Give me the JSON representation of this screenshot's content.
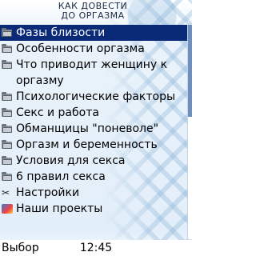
{
  "header": {
    "line1": "КАК ДОВЕСТИ",
    "line2": "ДО ОРГАЗМА"
  },
  "menu": {
    "items": [
      {
        "label": "Фазы близости",
        "icon": "folder-icon",
        "selected": true
      },
      {
        "label": "Особенности оргазма",
        "icon": "folder-icon"
      },
      {
        "label": "Что приводит женщину к оргазму",
        "icon": "folder-icon"
      },
      {
        "label": "Психологические факторы",
        "icon": "folder-icon"
      },
      {
        "label": "Секс и работа",
        "icon": "folder-icon"
      },
      {
        "label": "Обманщицы \"поневоле\"",
        "icon": "folder-icon"
      },
      {
        "label": "Оргазм и беременность",
        "icon": "folder-icon"
      },
      {
        "label": "Условия для секса",
        "icon": "folder-icon"
      },
      {
        "label": "6 правил секса",
        "icon": "folder-icon"
      },
      {
        "label": "Настройки",
        "icon": "wrench-icon"
      },
      {
        "label": "Наши проекты",
        "icon": "projects-icon"
      }
    ]
  },
  "softkeys": {
    "left": "Выбор",
    "clock": "12:45"
  },
  "colors": {
    "selection": "#0a2a78",
    "scrollbar": "#6e8fbd"
  }
}
